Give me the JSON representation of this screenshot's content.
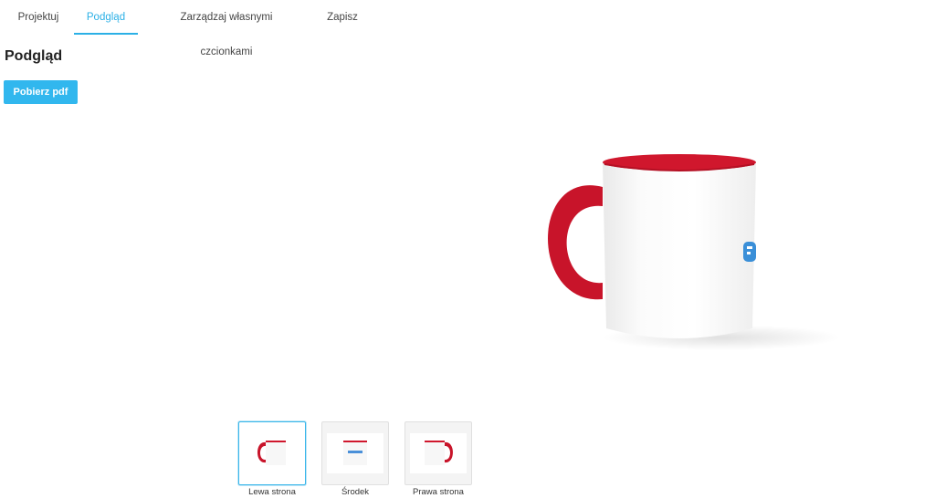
{
  "tabs": [
    {
      "label": "Projektuj"
    },
    {
      "label": "Podgląd"
    },
    {
      "label": "Zarządzaj własnymi czcionkami"
    },
    {
      "label": "Zapisz"
    }
  ],
  "page": {
    "title": "Podgląd",
    "download_button": "Pobierz pdf"
  },
  "thumbnails": [
    {
      "label": "Lewa strona"
    },
    {
      "label": "Środek"
    },
    {
      "label": "Prawa strona"
    }
  ],
  "colors": {
    "accent": "#31b7ee",
    "mug_red": "#d0172d"
  }
}
